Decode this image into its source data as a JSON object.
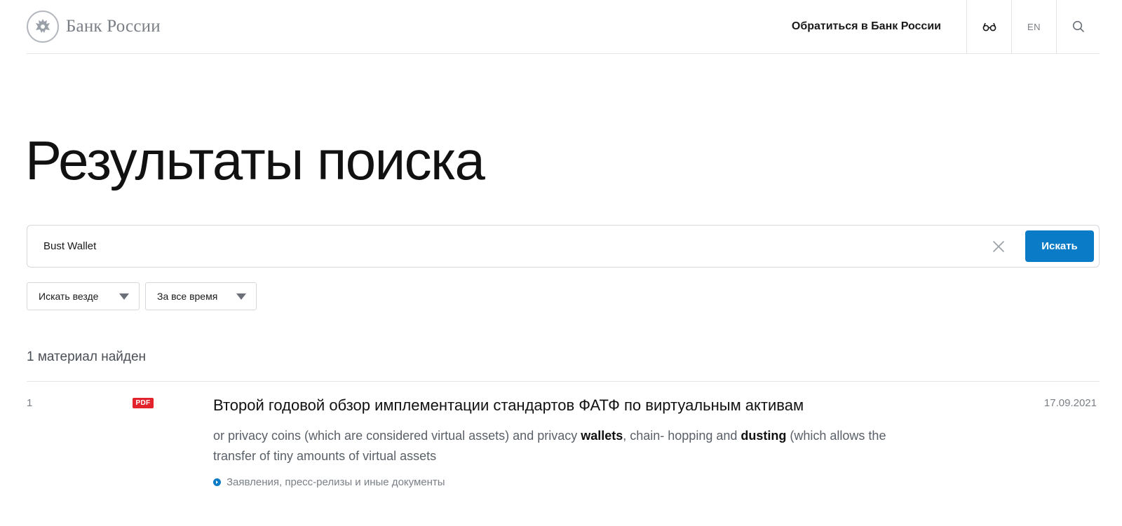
{
  "header": {
    "logo_text": "Банк России",
    "contact_label": "Обратиться в Банк России",
    "lang_label": "EN",
    "icons": {
      "emblem": "double-eagle-emblem-icon",
      "accessibility": "glasses-icon",
      "search": "search-icon"
    }
  },
  "page_title": "Результаты поиска",
  "search": {
    "value": "Bust Wallet",
    "placeholder": "",
    "submit_label": "Искать",
    "clear_icon": "close-icon"
  },
  "filters": [
    {
      "label": "Искать везде"
    },
    {
      "label": "За все время"
    }
  ],
  "results_count": "1 материал найден",
  "results": [
    {
      "number": "1",
      "badge": "PDF",
      "title": "Второй годовой обзор имплементации стандартов ФАТФ по виртуальным активам",
      "date": "17.09.2021",
      "snippet_parts": [
        "or privacy coins (which are considered virtual assets) and privacy ",
        "wallets",
        ", chain- hopping and ",
        "dusting",
        " (which allows the transfer of tiny amounts of virtual assets"
      ],
      "category": "Заявления, пресс-релизы и иные документы"
    }
  ],
  "colors": {
    "accent": "#0a7bc6",
    "pdf_badge": "#e3232b",
    "border": "#d5d8dc",
    "muted_text": "#7a7f86"
  }
}
